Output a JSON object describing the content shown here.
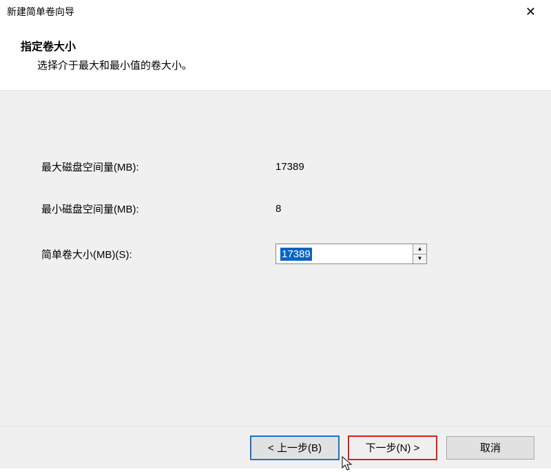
{
  "window": {
    "title": "新建简单卷向导"
  },
  "header": {
    "heading": "指定卷大小",
    "subheading": "选择介于最大和最小值的卷大小。"
  },
  "fields": {
    "max_label": "最大磁盘空间量(MB):",
    "max_value": "17389",
    "min_label": "最小磁盘空间量(MB):",
    "min_value": "8",
    "size_label": "简单卷大小(MB)(S):",
    "size_value": "17389"
  },
  "buttons": {
    "back": "< 上一步(B)",
    "next": "下一步(N) >",
    "cancel": "取消"
  }
}
